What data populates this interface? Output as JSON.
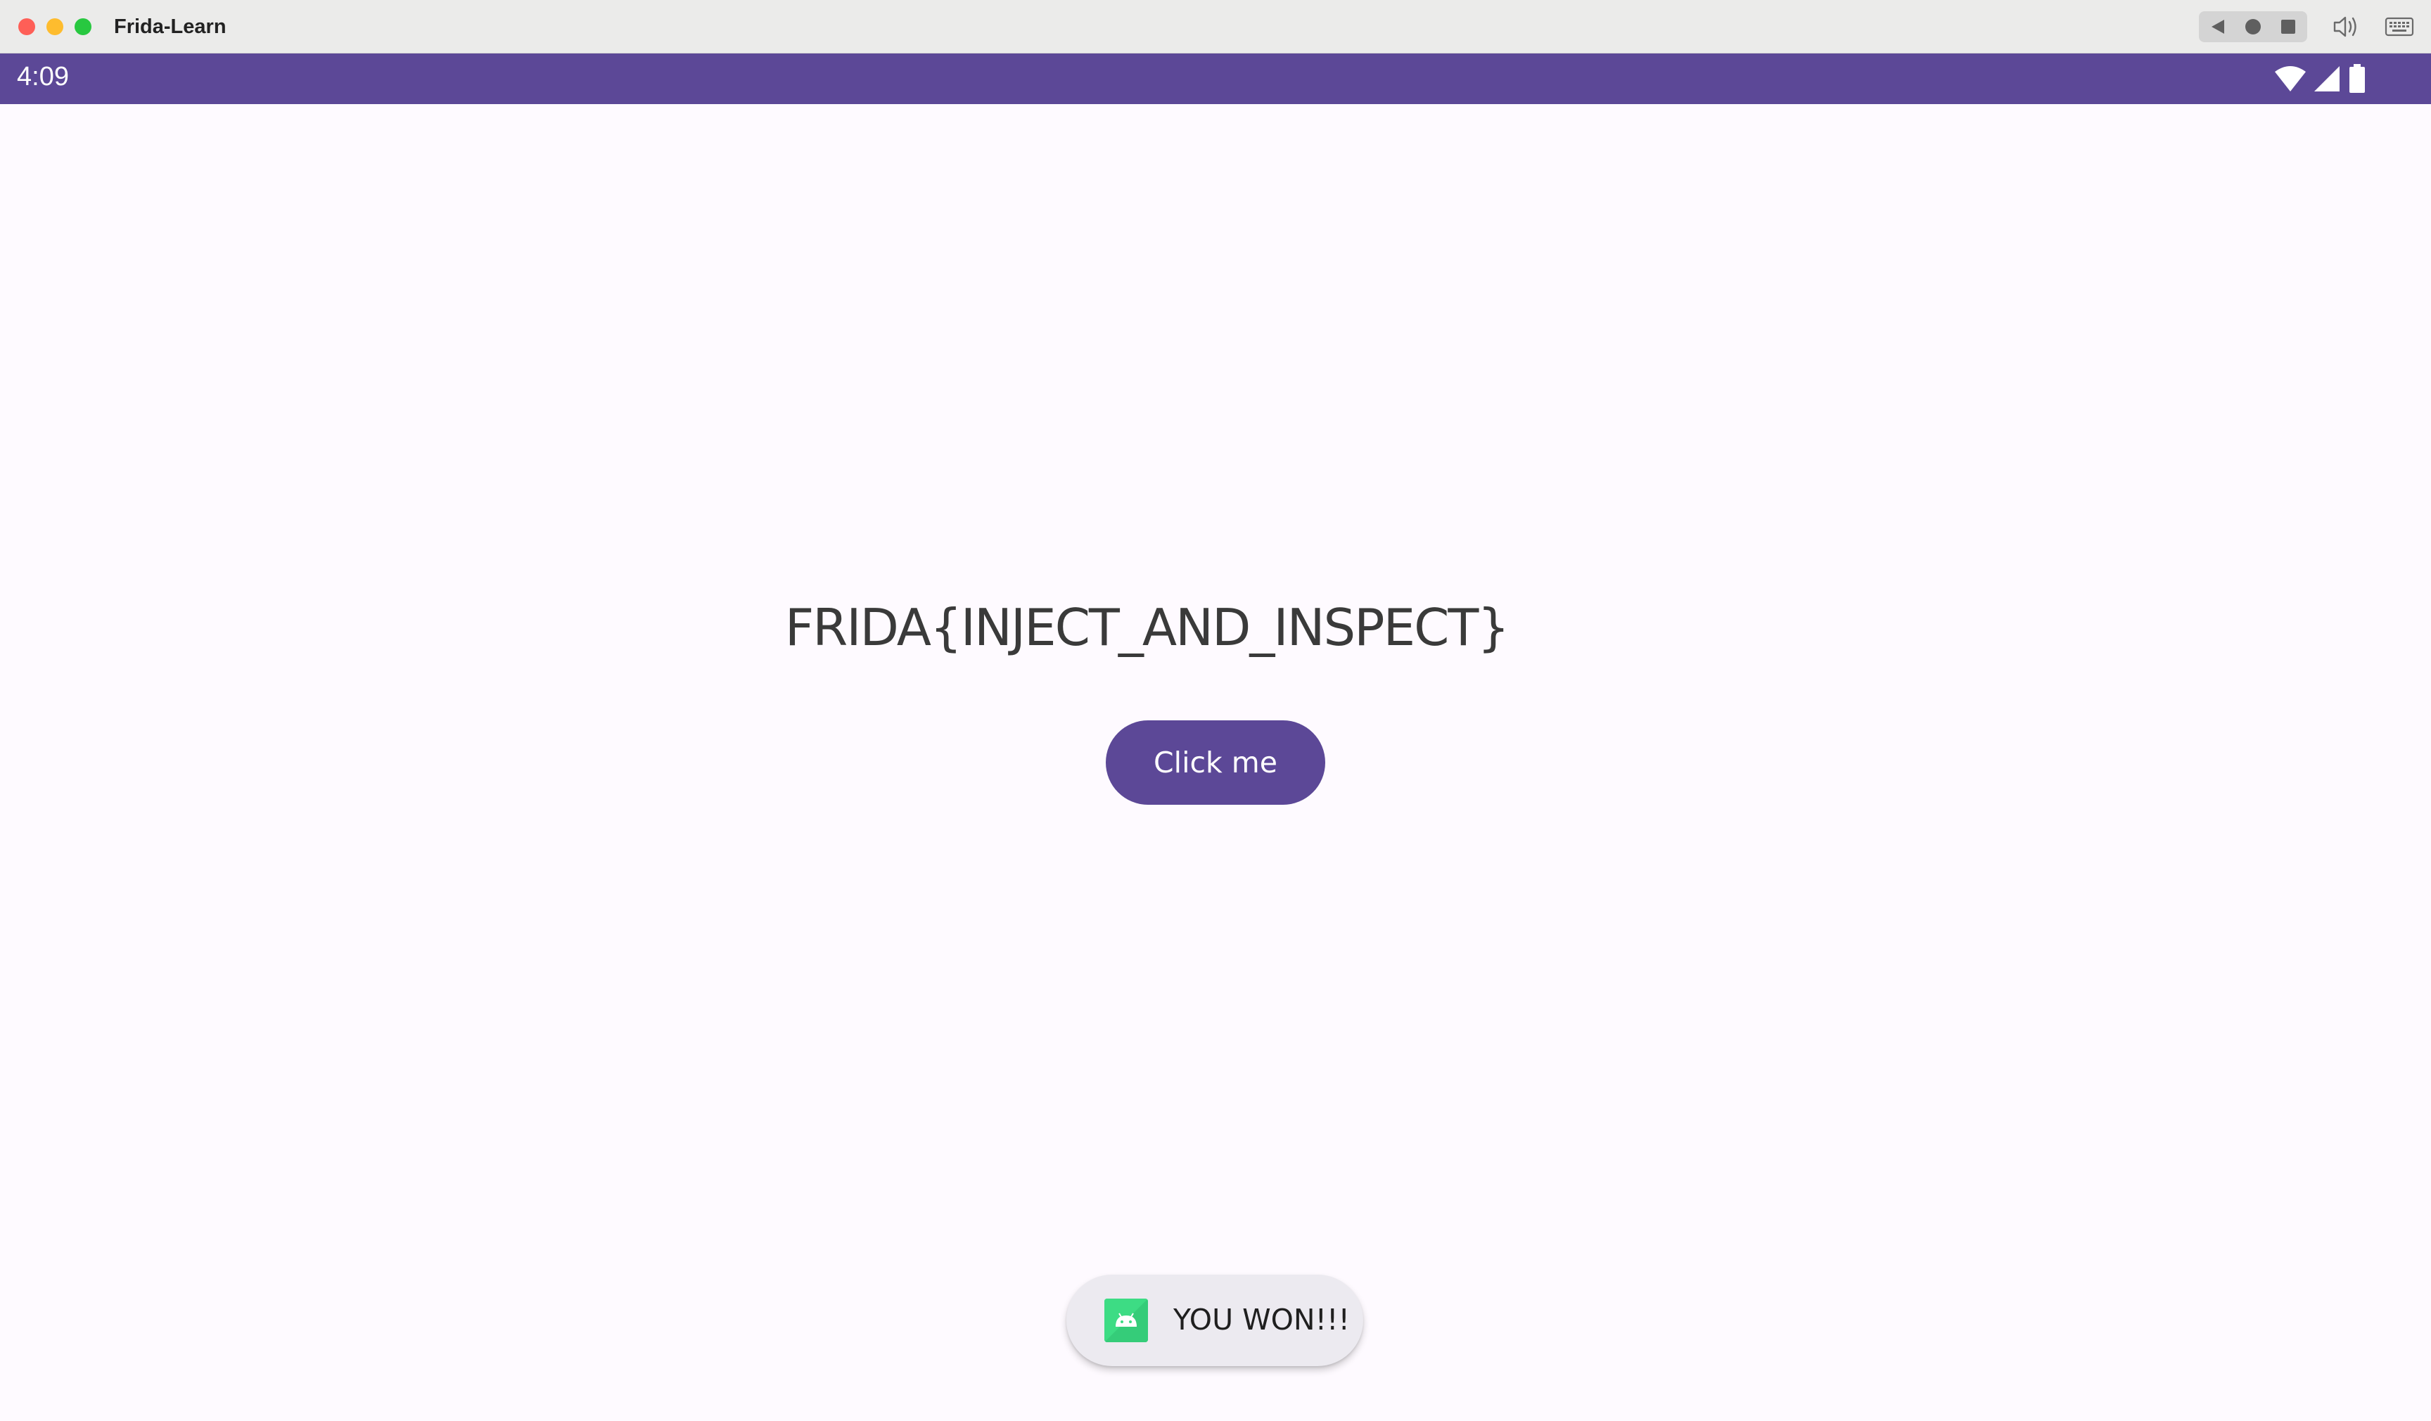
{
  "window": {
    "title": "Frida-Learn"
  },
  "titlebar": {
    "nav_icons": [
      "back-icon",
      "home-icon",
      "recents-icon"
    ],
    "right_icons": [
      "volume-icon",
      "keyboard-icon"
    ]
  },
  "statusbar": {
    "time": "4:09",
    "icons": [
      "wifi-icon",
      "signal-icon",
      "battery-icon"
    ],
    "color": "#5c4897"
  },
  "main": {
    "flag_text": "FRIDA{INJECT_AND_INSPECT}",
    "button_label": "Click me",
    "button_color": "#5c4897"
  },
  "toast": {
    "message": "YOU WON!!!",
    "icon": "android-app-icon",
    "icon_color": "#3ddc84"
  }
}
